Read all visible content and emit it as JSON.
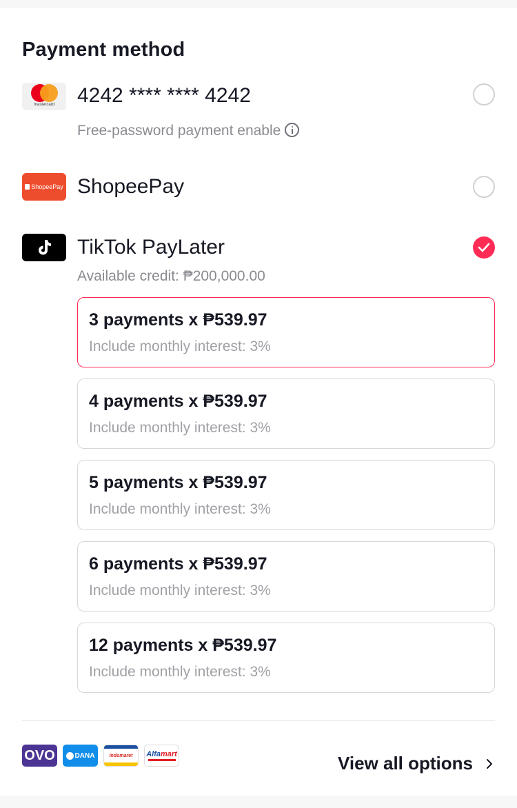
{
  "section": {
    "title": "Payment method"
  },
  "methods": [
    {
      "logo": "mastercard-logo",
      "logo_text": "mastercard",
      "label": "4242 **** **** 4242",
      "note": "Free-password payment enable",
      "selected": false
    },
    {
      "logo": "shopeepay-logo",
      "logo_text": "ShopeePay",
      "label": "ShopeePay",
      "selected": false
    },
    {
      "logo": "tiktok-logo",
      "label": "TikTok PayLater",
      "note": "Available credit: ₱200,000.00",
      "selected": true
    }
  ],
  "installments": [
    {
      "main": "3 payments x ₱539.97",
      "sub": "Include monthly interest: 3%",
      "selected": true
    },
    {
      "main": "4 payments x ₱539.97",
      "sub": "Include monthly interest: 3%",
      "selected": false
    },
    {
      "main": "5 payments x ₱539.97",
      "sub": "Include monthly interest: 3%",
      "selected": false
    },
    {
      "main": "6 payments x ₱539.97",
      "sub": "Include monthly interest: 3%",
      "selected": false
    },
    {
      "main": "12 payments x ₱539.97",
      "sub": "Include monthly interest: 3%",
      "selected": false
    }
  ],
  "other_options": {
    "logos": [
      {
        "name": "ovo-logo",
        "text": "OVO"
      },
      {
        "name": "dana-logo",
        "text": "DANA"
      },
      {
        "name": "indomaret-logo",
        "text": "Indomaret"
      },
      {
        "name": "alfamart-logo",
        "text": "Alfa",
        "text2": "mart"
      }
    ],
    "view_all_label": "View all options"
  },
  "colors": {
    "accent": "#fe2c55",
    "text_primary": "#161823",
    "text_secondary": "#8a8b91",
    "border": "#d6d7da"
  }
}
